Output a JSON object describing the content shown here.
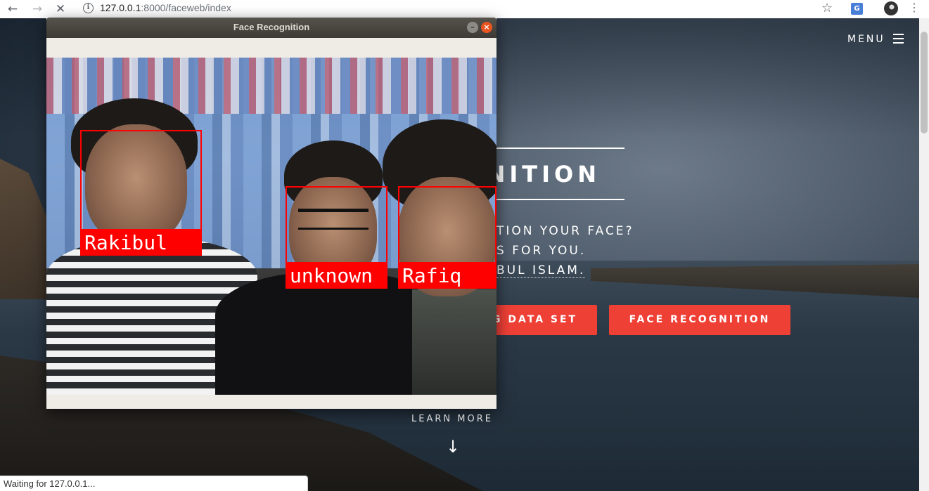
{
  "browser": {
    "url_host": "127.0.0.1",
    "url_rest": ":8000/faceweb/index",
    "status_text": "Waiting for 127.0.0.1..."
  },
  "site": {
    "menu_label": "MENU",
    "title_visible": "NITION",
    "subtitle_lines": [
      "TION YOUR FACE?",
      "S FOR YOU.",
      "BUL ISLAM."
    ],
    "button_dataset": "G DATA SET",
    "button_recognition": "FACE RECOGNITION",
    "learn_more": "LEARN MORE",
    "accent_color": "#ef4036"
  },
  "window": {
    "title": "Face Recognition",
    "faces": [
      {
        "name": "Rakibul"
      },
      {
        "name": "unknown"
      },
      {
        "name": "Rafiq"
      }
    ],
    "box_color": "#ff0000"
  },
  "icons": {
    "back": "arrow-left-icon",
    "forward": "arrow-right-icon",
    "stop": "close-icon",
    "info": "info-icon",
    "bookmark": "star-icon",
    "translate": "translate-icon",
    "menu": "hamburger-icon",
    "scroll_down": "arrow-down-icon"
  }
}
